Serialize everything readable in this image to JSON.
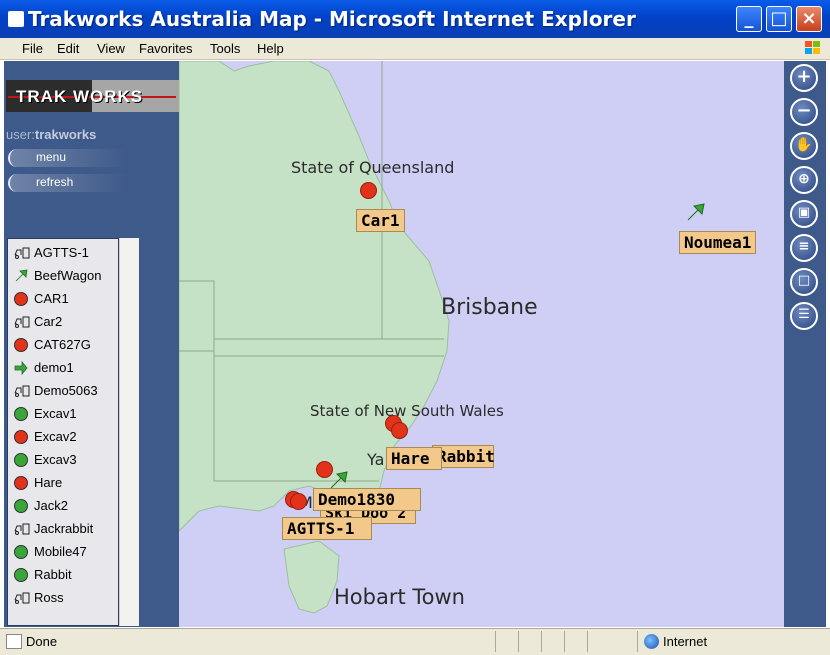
{
  "window": {
    "title": "Trakworks Australia Map - Microsoft Internet Explorer"
  },
  "menu": [
    "File",
    "Edit",
    "View",
    "Favorites",
    "Tools",
    "Help"
  ],
  "logo": {
    "text": "TRAK WORKS"
  },
  "user": {
    "prefix": "user:",
    "name": "trakworks"
  },
  "nav": {
    "menu_label": "menu",
    "refresh_label": "refresh"
  },
  "vehicles": [
    {
      "label": "AGTTS-1",
      "icon": "truck-outline-icon",
      "color": ""
    },
    {
      "label": "BeefWagon",
      "icon": "arrow-up-right-icon",
      "color": "#3aa63a"
    },
    {
      "label": "CAR1",
      "icon": "dot-icon",
      "color": "#e2331a"
    },
    {
      "label": "Car2",
      "icon": "truck-outline-icon",
      "color": ""
    },
    {
      "label": "CAT627G",
      "icon": "dot-icon",
      "color": "#e2331a"
    },
    {
      "label": "demo1",
      "icon": "arrow-right-icon",
      "color": "#3aa63a"
    },
    {
      "label": "Demo5063",
      "icon": "truck-outline-icon",
      "color": ""
    },
    {
      "label": "Excav1",
      "icon": "dot-icon",
      "color": "#3aa63a"
    },
    {
      "label": "Excav2",
      "icon": "dot-icon",
      "color": "#e2331a"
    },
    {
      "label": "Excav3",
      "icon": "dot-icon",
      "color": "#3aa63a"
    },
    {
      "label": "Hare",
      "icon": "dot-icon",
      "color": "#e2331a"
    },
    {
      "label": "Jack2",
      "icon": "dot-icon",
      "color": "#3aa63a"
    },
    {
      "label": "Jackrabbit",
      "icon": "truck-outline-icon",
      "color": ""
    },
    {
      "label": "Mobile47",
      "icon": "dot-icon",
      "color": "#3aa63a"
    },
    {
      "label": "Rabbit",
      "icon": "dot-icon",
      "color": "#3aa63a"
    },
    {
      "label": "Ross",
      "icon": "truck-outline-icon",
      "color": ""
    }
  ],
  "map": {
    "places": [
      "State of Queensland",
      "Brisbane",
      "State of New South Wales",
      "Hobart Town",
      "Ya",
      "Me"
    ],
    "tags": [
      "Car1",
      "Noumea1",
      "Hare",
      "Rabbit",
      "Demo1830",
      "Ski Doo 2",
      "AGTTS-1"
    ]
  },
  "tools": [
    "zoom-in-icon",
    "zoom-out-icon",
    "pan-hand-icon",
    "center-target-icon",
    "vehicle-icon",
    "layers-icon",
    "fullscreen-icon",
    "list-icon"
  ],
  "status": {
    "text": "Done",
    "zone": "Internet"
  },
  "colors": {
    "land": "#c6e2c6",
    "sea": "#cfcff6",
    "marker_red": "#e2331a",
    "marker_green": "#3aa63a",
    "tag": "#f2c98a"
  }
}
